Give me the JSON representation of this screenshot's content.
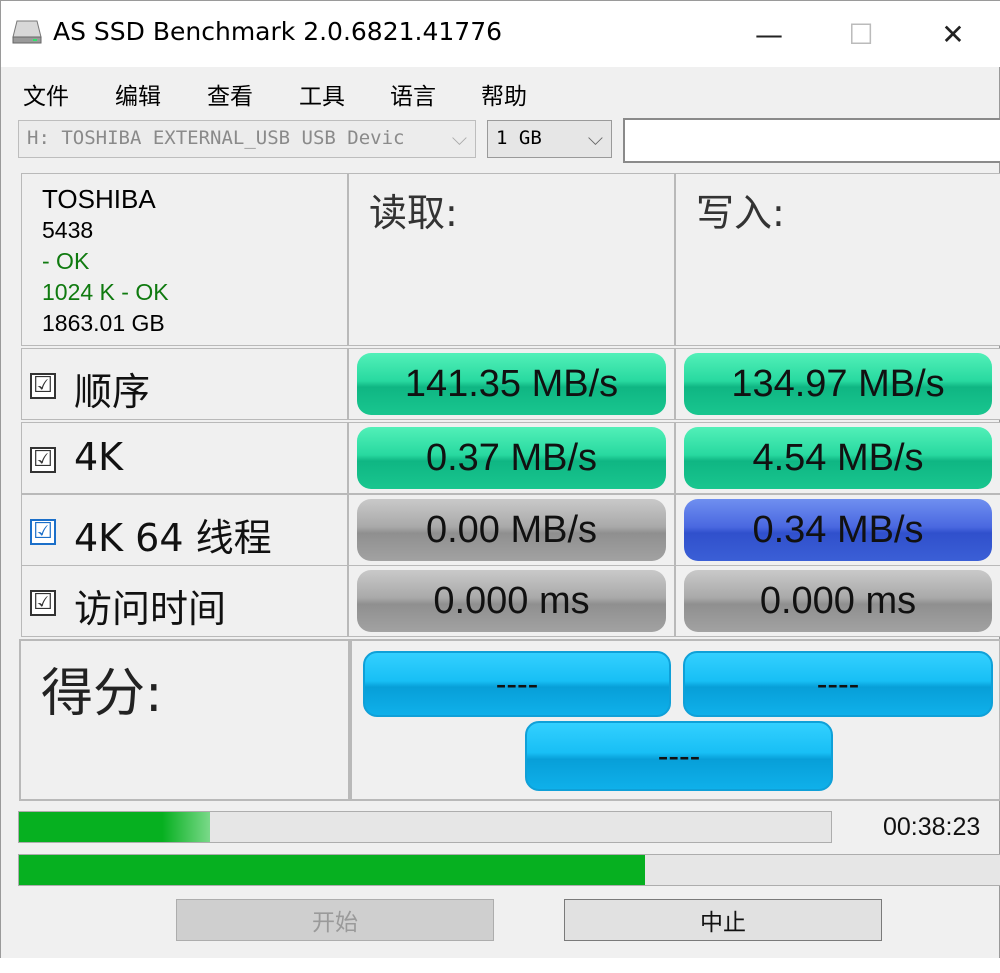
{
  "window": {
    "title": "AS SSD Benchmark 2.0.6821.41776",
    "minimize": "—",
    "maximize": "☐",
    "close": "✕"
  },
  "menu": [
    "文件",
    "编辑",
    "查看",
    "工具",
    "语言",
    "帮助"
  ],
  "toolbar": {
    "drive": "H: TOSHIBA EXTERNAL_USB USB Devic",
    "size": "1 GB",
    "text_value": ""
  },
  "info": {
    "model": "TOSHIBA",
    "firmware": "5438",
    "driver_status": " - OK",
    "alignment": "1024 K - OK",
    "capacity": "1863.01 GB"
  },
  "headers": {
    "read": "读取:",
    "write": "写入:"
  },
  "rows": [
    {
      "label": "顺序",
      "checked": "☑",
      "read": "141.35 MB/s",
      "write": "134.97 MB/s"
    },
    {
      "label": "4K",
      "checked": "☑",
      "read": "0.37 MB/s",
      "write": "4.54 MB/s"
    },
    {
      "label": "4K 64 线程",
      "checked": "☑",
      "read": "0.00 MB/s",
      "write": "0.34 MB/s"
    },
    {
      "label": "访问时间",
      "checked": "☑",
      "read": "0.000 ms",
      "write": "0.000 ms"
    }
  ],
  "score": {
    "label": "得分:",
    "read": "----",
    "write": "----",
    "total": "----"
  },
  "progress": {
    "current_fraction": 0.235,
    "overall_fraction": 0.638,
    "elapsed": "00:38:23"
  },
  "buttons": {
    "start": "开始",
    "stop": "中止"
  },
  "colors": {
    "green_result": "#28d9a0",
    "gray_result": "#a9a9a9",
    "blue_result": "#4a68e0",
    "score_cyan": "#18bff5",
    "progress_green": "#06b020"
  }
}
